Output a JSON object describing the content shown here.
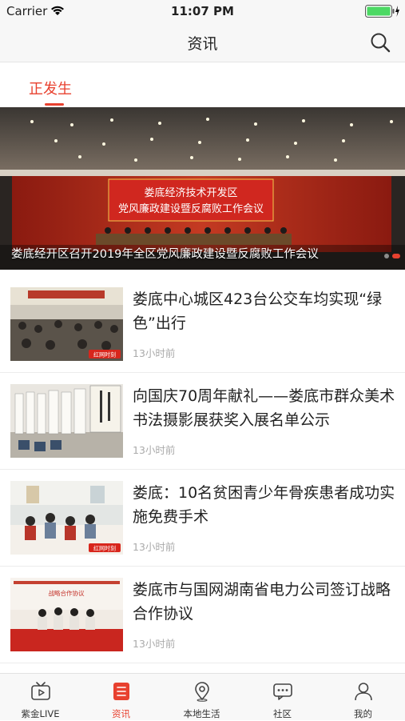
{
  "status_bar": {
    "carrier": "Carrier",
    "time": "11:07 PM"
  },
  "navbar": {
    "title": "资讯",
    "search_icon": "search-icon"
  },
  "tabs": [
    {
      "label": "正发生",
      "active": true
    }
  ],
  "banner": {
    "slide_title": "娄底经开区召开2019年全区党风廉政建设暨反腐败工作会议",
    "screen_line1": "娄底经济技术开发区",
    "screen_line2": "党风廉政建设暨反腐败工作会议",
    "page_count": 2,
    "active_page": 2
  },
  "articles": [
    {
      "title": "娄底中心城区423台公交车均实现“绿色”出行",
      "time": "13小时前",
      "thumb_watermark": "红网时刻"
    },
    {
      "title": "向国庆70周年献礼——娄底市群众美术书法摄影展获奖入展名单公示",
      "time": "13小时前",
      "thumb_watermark": ""
    },
    {
      "title": "娄底：10名贫困青少年骨疾患者成功实施免费手术",
      "time": "13小时前",
      "thumb_watermark": "红网时刻"
    },
    {
      "title": "娄底市与国网湖南省电力公司签订战略合作协议",
      "time": "13小时前",
      "thumb_watermark": "战略合作协议"
    }
  ],
  "tabbar": [
    {
      "label": "紫金LIVE",
      "icon": "tv-icon"
    },
    {
      "label": "资讯",
      "icon": "news-list-icon",
      "active": true
    },
    {
      "label": "本地生活",
      "icon": "location-pin-icon"
    },
    {
      "label": "社区",
      "icon": "chat-bubbles-icon"
    },
    {
      "label": "我的",
      "icon": "person-icon"
    }
  ],
  "colors": {
    "accent": "#e8412f",
    "banner_screen": "#d0271f"
  }
}
